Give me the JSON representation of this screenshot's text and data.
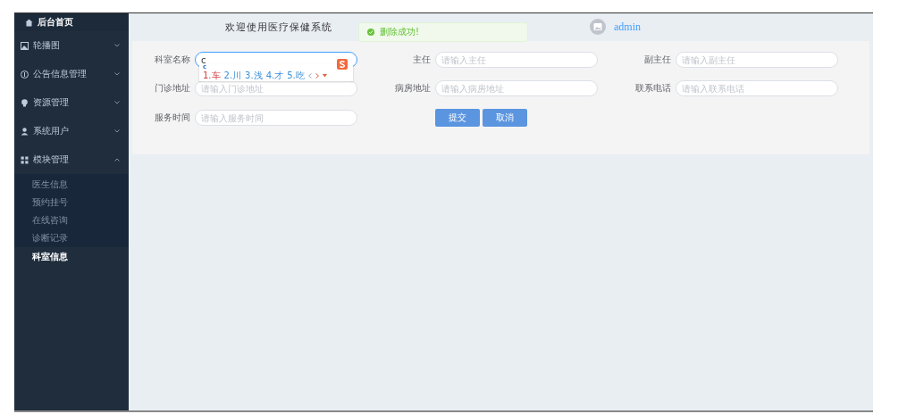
{
  "sidebar": {
    "items": [
      {
        "label": "后台首页",
        "kind": "home"
      },
      {
        "label": "轮播图",
        "kind": "group",
        "expanded": false
      },
      {
        "label": "公告信息管理",
        "kind": "group",
        "expanded": false
      },
      {
        "label": "资源管理",
        "kind": "group",
        "expanded": false
      },
      {
        "label": "系统用户",
        "kind": "group",
        "expanded": false
      },
      {
        "label": "模块管理",
        "kind": "group",
        "expanded": true,
        "children": [
          {
            "label": "医生信息",
            "selected": false
          },
          {
            "label": "预约挂号",
            "selected": false
          },
          {
            "label": "在线咨询",
            "selected": false
          },
          {
            "label": "诊断记录",
            "selected": false
          },
          {
            "label": "科室信息",
            "selected": true
          }
        ]
      }
    ]
  },
  "header": {
    "title": "欢迎使用医疗保健系统",
    "user": "admin"
  },
  "toast": {
    "message": "删除成功!"
  },
  "form": {
    "fields": [
      {
        "label": "科室名称",
        "value": "c",
        "focused": true
      },
      {
        "label": "主任",
        "placeholder": "请输入主任",
        "focused": false
      },
      {
        "label": "副主任",
        "placeholder": "请输入副主任",
        "focused": false
      },
      {
        "label": "门诊地址",
        "placeholder": "请输入门诊地址",
        "focused": false
      },
      {
        "label": "病房地址",
        "placeholder": "请输入病房地址",
        "focused": false
      },
      {
        "label": "联系电话",
        "placeholder": "请输入联系电话",
        "focused": false
      },
      {
        "label": "服务时间",
        "placeholder": "请输入服务时间",
        "focused": false
      }
    ],
    "buttons": [
      "提交",
      "取消"
    ]
  },
  "ime": {
    "composition": "c",
    "candidates": [
      "1.车",
      "2.川",
      "3.浅",
      "4.才",
      "5.吃"
    ]
  }
}
